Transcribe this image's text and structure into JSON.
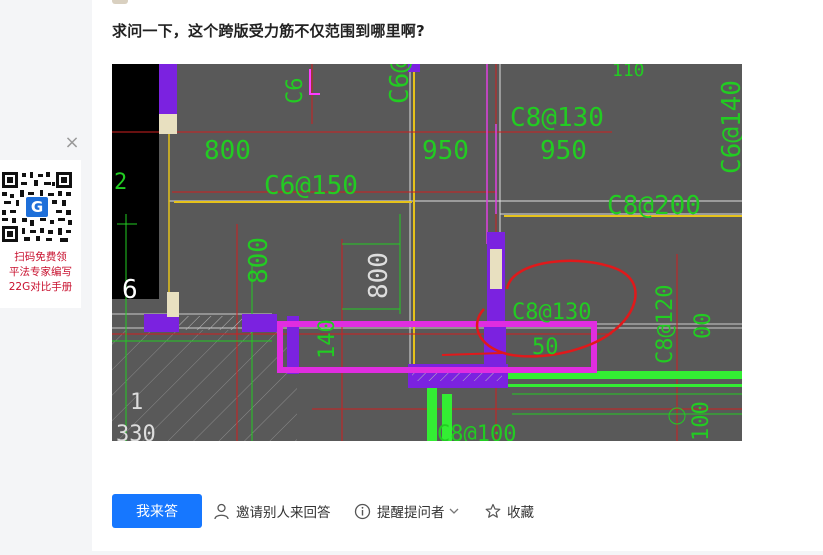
{
  "question": {
    "title": "求问一下，这个跨版受力筋不仅范围到哪里啊?"
  },
  "drawing": {
    "labels": {
      "c6_150_top": "C6@150",
      "c6_150_h": "C6@150",
      "c8_130_top": "C8@130",
      "c6_140": "C6@140",
      "c8_200": "C8@200",
      "c8_130_mid": "C8@130",
      "c8_120": "C8@120",
      "c8_100": "C8@100",
      "dim_800_left": "800",
      "dim_950_a": "950",
      "dim_950_b": "950",
      "dim_800_v1": "800",
      "dim_800_v2": "800",
      "dim_140": "140",
      "num_6": "6",
      "num_2": "2",
      "num_1": "1",
      "num_330": "330",
      "num_100": "100",
      "top_110": "110",
      "top_c6": "C6",
      "frag_50": "50",
      "frag_00": "00"
    }
  },
  "side_ad": {
    "close_symbol": "×",
    "line1": "扫码免费领",
    "line2": "平法专家编写",
    "line3": "22G对比手册",
    "logo_letter": "G"
  },
  "actions": {
    "answer": "我来答",
    "invite": "邀请别人来回答",
    "remind": "提醒提问者",
    "favorite": "收藏"
  },
  "colors": {
    "accent": "#1677ff",
    "cad_background": "#595959",
    "ad_text": "#c8102e",
    "highlight_magenta": "#e02de0",
    "annotation_red": "#e0191b"
  },
  "icons": [
    "person-icon",
    "info-icon",
    "chevron-down-icon",
    "star-icon",
    "close-icon",
    "qr-code",
    "g-logo-icon"
  ]
}
